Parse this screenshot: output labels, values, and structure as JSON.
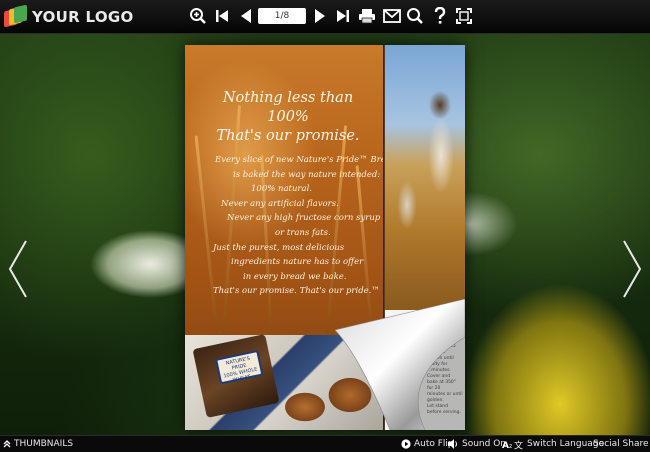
{
  "toolbar": {
    "logo_text": "YOUR LOGO",
    "page_indicator": "1/8",
    "icons": [
      "zoom-in-icon",
      "first-page-icon",
      "previous-page-icon",
      "next-page-icon",
      "last-page-icon",
      "print-icon",
      "email-icon",
      "search-icon",
      "help-icon",
      "fullscreen-icon"
    ]
  },
  "book": {
    "left_page": {
      "headline": [
        "Nothing less than 100%",
        "That's our promise."
      ],
      "body": [
        "Every slice of new Nature's Pride™ Bread",
        "is baked the way nature intended:",
        "100% natural.",
        "Never any artificial flavors.",
        "Never any high fructose corn syrup",
        "or trans fats.",
        "Just the purest, most delicious",
        "ingredients nature has to offer",
        "in every bread we bake.",
        "That's our promise. That's our pride.™"
      ],
      "bag_label": [
        "NATURE'S",
        "PRIDE",
        "100% WHOLE",
        "WHEAT"
      ]
    },
    "right_page": {
      "small_text": [
        "...ingredients. There's the",
        "difference. Remove",
        "dough 10-15 minutes",
        "...oven until ready for",
        "...minutes. Cover and",
        "bake at 350° for 20",
        "minutes or until golden.",
        "Let stand before serving."
      ]
    }
  },
  "bottombar": {
    "thumbnails": "THUMBNAILS",
    "auto_flip": "Auto Flip",
    "sound_on": "Sound On",
    "switch_language": "Switch Language",
    "social_share": "Social Share"
  },
  "colors": {
    "toolbar_bg": "#0a0a0a",
    "page_orange": "#b8651c",
    "icon_white": "#ffffff"
  }
}
